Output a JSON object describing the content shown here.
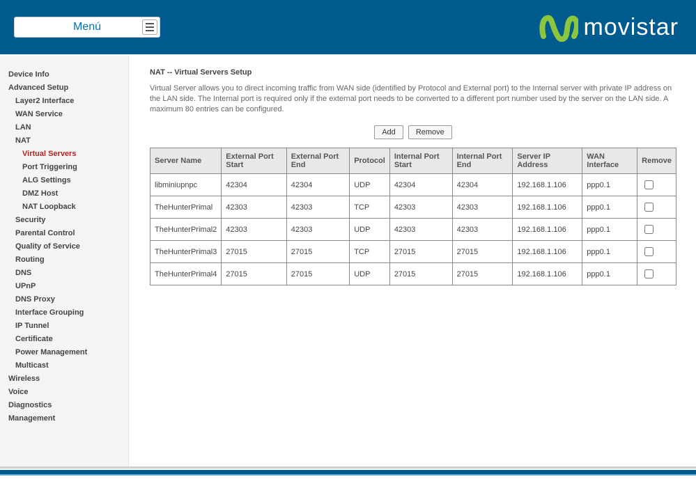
{
  "header": {
    "menu_label": "Menú",
    "brand_text": "movistar"
  },
  "sidebar": {
    "items": [
      {
        "label": "Device Info",
        "level": 1
      },
      {
        "label": "Advanced Setup",
        "level": 1
      },
      {
        "label": "Layer2 Interface",
        "level": 2
      },
      {
        "label": "WAN Service",
        "level": 2
      },
      {
        "label": "LAN",
        "level": 2
      },
      {
        "label": "NAT",
        "level": 2
      },
      {
        "label": "Virtual Servers",
        "level": 3,
        "active": true
      },
      {
        "label": "Port Triggering",
        "level": 3
      },
      {
        "label": "ALG Settings",
        "level": 3
      },
      {
        "label": "DMZ Host",
        "level": 3
      },
      {
        "label": "NAT Loopback",
        "level": 3
      },
      {
        "label": "Security",
        "level": 2
      },
      {
        "label": "Parental Control",
        "level": 2
      },
      {
        "label": "Quality of Service",
        "level": 2
      },
      {
        "label": "Routing",
        "level": 2
      },
      {
        "label": "DNS",
        "level": 2
      },
      {
        "label": "UPnP",
        "level": 2
      },
      {
        "label": "DNS Proxy",
        "level": 2
      },
      {
        "label": "Interface Grouping",
        "level": 2
      },
      {
        "label": "IP Tunnel",
        "level": 2
      },
      {
        "label": "Certificate",
        "level": 2
      },
      {
        "label": "Power Management",
        "level": 2
      },
      {
        "label": "Multicast",
        "level": 2
      },
      {
        "label": "Wireless",
        "level": 1
      },
      {
        "label": "Voice",
        "level": 1
      },
      {
        "label": "Diagnostics",
        "level": 1
      },
      {
        "label": "Management",
        "level": 1
      }
    ]
  },
  "main": {
    "title": "NAT -- Virtual Servers Setup",
    "description": "Virtual Server allows you to direct incoming traffic from WAN side (identified by Protocol and External port) to the Internal server with private IP address on the LAN side. The Internal port is required only if the external port needs to be converted to a different port number used by the server on the LAN side. A maximum 80 entries can be configured.",
    "buttons": {
      "add": "Add",
      "remove": "Remove"
    },
    "table": {
      "headers": {
        "server_name": "Server Name",
        "ext_start": "External Port Start",
        "ext_end": "External Port End",
        "protocol": "Protocol",
        "int_start": "Internal Port Start",
        "int_end": "Internal Port End",
        "server_ip": "Server IP Address",
        "wan_if": "WAN Interface",
        "remove": "Remove"
      },
      "rows": [
        {
          "server_name": "libminiupnpc",
          "ext_start": "42304",
          "ext_end": "42304",
          "protocol": "UDP",
          "int_start": "42304",
          "int_end": "42304",
          "server_ip": "192.168.1.106",
          "wan_if": "ppp0.1"
        },
        {
          "server_name": "TheHunterPrimal",
          "ext_start": "42303",
          "ext_end": "42303",
          "protocol": "TCP",
          "int_start": "42303",
          "int_end": "42303",
          "server_ip": "192.168.1.106",
          "wan_if": "ppp0.1"
        },
        {
          "server_name": "TheHunterPrimal2",
          "ext_start": "42303",
          "ext_end": "42303",
          "protocol": "UDP",
          "int_start": "42303",
          "int_end": "42303",
          "server_ip": "192.168.1.106",
          "wan_if": "ppp0.1"
        },
        {
          "server_name": "TheHunterPrimal3",
          "ext_start": "27015",
          "ext_end": "27015",
          "protocol": "TCP",
          "int_start": "27015",
          "int_end": "27015",
          "server_ip": "192.168.1.106",
          "wan_if": "ppp0.1"
        },
        {
          "server_name": "TheHunterPrimal4",
          "ext_start": "27015",
          "ext_end": "27015",
          "protocol": "UDP",
          "int_start": "27015",
          "int_end": "27015",
          "server_ip": "192.168.1.106",
          "wan_if": "ppp0.1"
        }
      ]
    }
  },
  "colors": {
    "header_bg": "#005b8f",
    "brand_green": "#8cc63f",
    "active_red": "#b22222",
    "menu_blue": "#0072b8"
  }
}
